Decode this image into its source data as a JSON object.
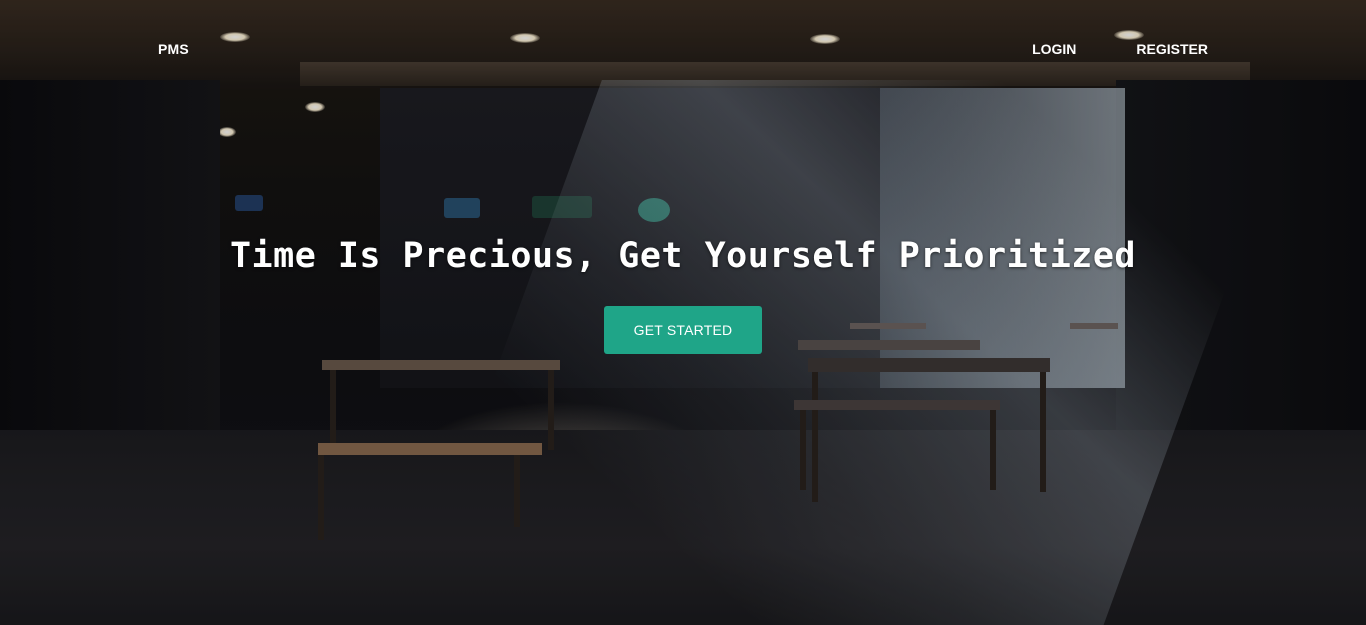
{
  "navbar": {
    "brand": "PMS",
    "links": [
      "LOGIN",
      "REGISTER"
    ]
  },
  "hero": {
    "headline": "Time Is Precious, Get Yourself Prioritized",
    "cta_label": "GET STARTED"
  },
  "colors": {
    "cta_background": "#1fa588",
    "text": "#ffffff"
  }
}
